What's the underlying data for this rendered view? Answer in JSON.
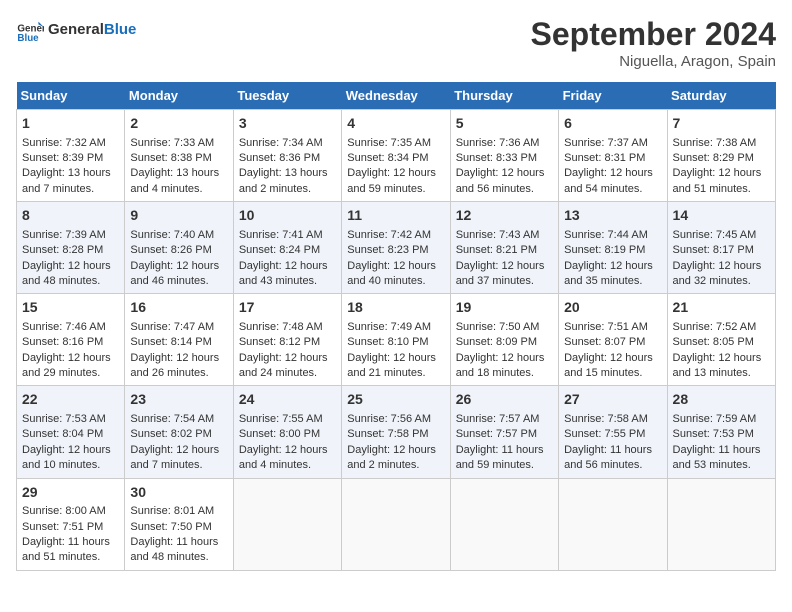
{
  "logo": {
    "text_general": "General",
    "text_blue": "Blue"
  },
  "title": "September 2024",
  "location": "Niguella, Aragon, Spain",
  "days_of_week": [
    "Sunday",
    "Monday",
    "Tuesday",
    "Wednesday",
    "Thursday",
    "Friday",
    "Saturday"
  ],
  "weeks": [
    [
      {
        "day": "1",
        "sunrise": "Sunrise: 7:32 AM",
        "sunset": "Sunset: 8:39 PM",
        "daylight": "Daylight: 13 hours and 7 minutes."
      },
      {
        "day": "2",
        "sunrise": "Sunrise: 7:33 AM",
        "sunset": "Sunset: 8:38 PM",
        "daylight": "Daylight: 13 hours and 4 minutes."
      },
      {
        "day": "3",
        "sunrise": "Sunrise: 7:34 AM",
        "sunset": "Sunset: 8:36 PM",
        "daylight": "Daylight: 13 hours and 2 minutes."
      },
      {
        "day": "4",
        "sunrise": "Sunrise: 7:35 AM",
        "sunset": "Sunset: 8:34 PM",
        "daylight": "Daylight: 12 hours and 59 minutes."
      },
      {
        "day": "5",
        "sunrise": "Sunrise: 7:36 AM",
        "sunset": "Sunset: 8:33 PM",
        "daylight": "Daylight: 12 hours and 56 minutes."
      },
      {
        "day": "6",
        "sunrise": "Sunrise: 7:37 AM",
        "sunset": "Sunset: 8:31 PM",
        "daylight": "Daylight: 12 hours and 54 minutes."
      },
      {
        "day": "7",
        "sunrise": "Sunrise: 7:38 AM",
        "sunset": "Sunset: 8:29 PM",
        "daylight": "Daylight: 12 hours and 51 minutes."
      }
    ],
    [
      {
        "day": "8",
        "sunrise": "Sunrise: 7:39 AM",
        "sunset": "Sunset: 8:28 PM",
        "daylight": "Daylight: 12 hours and 48 minutes."
      },
      {
        "day": "9",
        "sunrise": "Sunrise: 7:40 AM",
        "sunset": "Sunset: 8:26 PM",
        "daylight": "Daylight: 12 hours and 46 minutes."
      },
      {
        "day": "10",
        "sunrise": "Sunrise: 7:41 AM",
        "sunset": "Sunset: 8:24 PM",
        "daylight": "Daylight: 12 hours and 43 minutes."
      },
      {
        "day": "11",
        "sunrise": "Sunrise: 7:42 AM",
        "sunset": "Sunset: 8:23 PM",
        "daylight": "Daylight: 12 hours and 40 minutes."
      },
      {
        "day": "12",
        "sunrise": "Sunrise: 7:43 AM",
        "sunset": "Sunset: 8:21 PM",
        "daylight": "Daylight: 12 hours and 37 minutes."
      },
      {
        "day": "13",
        "sunrise": "Sunrise: 7:44 AM",
        "sunset": "Sunset: 8:19 PM",
        "daylight": "Daylight: 12 hours and 35 minutes."
      },
      {
        "day": "14",
        "sunrise": "Sunrise: 7:45 AM",
        "sunset": "Sunset: 8:17 PM",
        "daylight": "Daylight: 12 hours and 32 minutes."
      }
    ],
    [
      {
        "day": "15",
        "sunrise": "Sunrise: 7:46 AM",
        "sunset": "Sunset: 8:16 PM",
        "daylight": "Daylight: 12 hours and 29 minutes."
      },
      {
        "day": "16",
        "sunrise": "Sunrise: 7:47 AM",
        "sunset": "Sunset: 8:14 PM",
        "daylight": "Daylight: 12 hours and 26 minutes."
      },
      {
        "day": "17",
        "sunrise": "Sunrise: 7:48 AM",
        "sunset": "Sunset: 8:12 PM",
        "daylight": "Daylight: 12 hours and 24 minutes."
      },
      {
        "day": "18",
        "sunrise": "Sunrise: 7:49 AM",
        "sunset": "Sunset: 8:10 PM",
        "daylight": "Daylight: 12 hours and 21 minutes."
      },
      {
        "day": "19",
        "sunrise": "Sunrise: 7:50 AM",
        "sunset": "Sunset: 8:09 PM",
        "daylight": "Daylight: 12 hours and 18 minutes."
      },
      {
        "day": "20",
        "sunrise": "Sunrise: 7:51 AM",
        "sunset": "Sunset: 8:07 PM",
        "daylight": "Daylight: 12 hours and 15 minutes."
      },
      {
        "day": "21",
        "sunrise": "Sunrise: 7:52 AM",
        "sunset": "Sunset: 8:05 PM",
        "daylight": "Daylight: 12 hours and 13 minutes."
      }
    ],
    [
      {
        "day": "22",
        "sunrise": "Sunrise: 7:53 AM",
        "sunset": "Sunset: 8:04 PM",
        "daylight": "Daylight: 12 hours and 10 minutes."
      },
      {
        "day": "23",
        "sunrise": "Sunrise: 7:54 AM",
        "sunset": "Sunset: 8:02 PM",
        "daylight": "Daylight: 12 hours and 7 minutes."
      },
      {
        "day": "24",
        "sunrise": "Sunrise: 7:55 AM",
        "sunset": "Sunset: 8:00 PM",
        "daylight": "Daylight: 12 hours and 4 minutes."
      },
      {
        "day": "25",
        "sunrise": "Sunrise: 7:56 AM",
        "sunset": "Sunset: 7:58 PM",
        "daylight": "Daylight: 12 hours and 2 minutes."
      },
      {
        "day": "26",
        "sunrise": "Sunrise: 7:57 AM",
        "sunset": "Sunset: 7:57 PM",
        "daylight": "Daylight: 11 hours and 59 minutes."
      },
      {
        "day": "27",
        "sunrise": "Sunrise: 7:58 AM",
        "sunset": "Sunset: 7:55 PM",
        "daylight": "Daylight: 11 hours and 56 minutes."
      },
      {
        "day": "28",
        "sunrise": "Sunrise: 7:59 AM",
        "sunset": "Sunset: 7:53 PM",
        "daylight": "Daylight: 11 hours and 53 minutes."
      }
    ],
    [
      {
        "day": "29",
        "sunrise": "Sunrise: 8:00 AM",
        "sunset": "Sunset: 7:51 PM",
        "daylight": "Daylight: 11 hours and 51 minutes."
      },
      {
        "day": "30",
        "sunrise": "Sunrise: 8:01 AM",
        "sunset": "Sunset: 7:50 PM",
        "daylight": "Daylight: 11 hours and 48 minutes."
      },
      null,
      null,
      null,
      null,
      null
    ]
  ]
}
